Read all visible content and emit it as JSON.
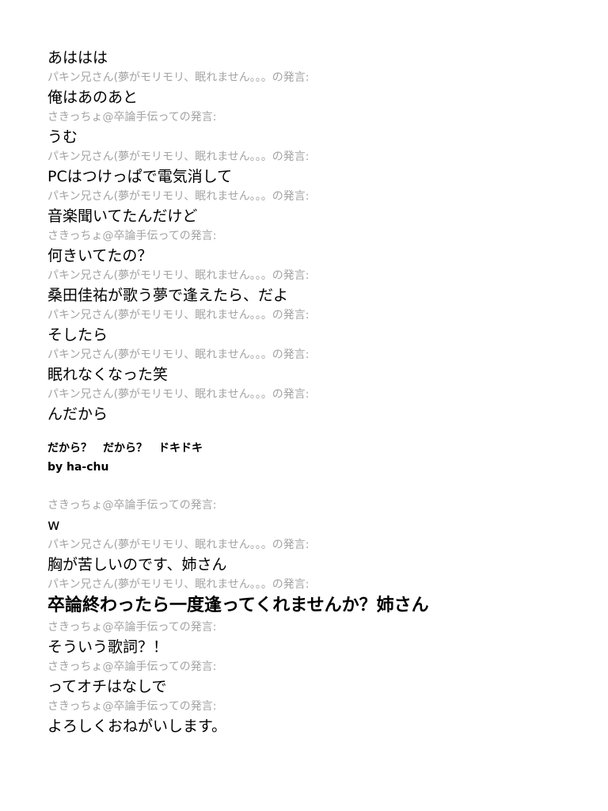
{
  "speakers": {
    "pakin": "パキン兄さん(夢がモリモリ、眠れません。。。の発言:",
    "saki": "さきっちょ@卒論手伝っての発言:"
  },
  "messages": [
    {
      "text": "あははは"
    },
    {
      "text": "俺はあのあと"
    },
    {
      "text": "うむ"
    },
    {
      "text": "PCはつけっぱで電気消して"
    },
    {
      "text": "音楽聞いてたんだけど"
    },
    {
      "text": "何きいてたの？"
    },
    {
      "text": "桑田佳祐が歌う夢で逢えたら、だよ"
    },
    {
      "text": "そしたら"
    },
    {
      "text": "眠れなくなった笑"
    },
    {
      "text": "んだから"
    }
  ],
  "interlude": {
    "line1": "だから？　だから？　ドキドキ",
    "line2": "by ha-chu"
  },
  "messages2": [
    {
      "text": "w"
    },
    {
      "text": "胸が苦しいのです、姉さん"
    },
    {
      "text": "卒論終わったら一度逢ってくれませんか？姉さん"
    },
    {
      "text": "そういう歌詞？！"
    },
    {
      "text": "ってオチはなしで"
    },
    {
      "text": "よろしくおねがいします。"
    }
  ]
}
